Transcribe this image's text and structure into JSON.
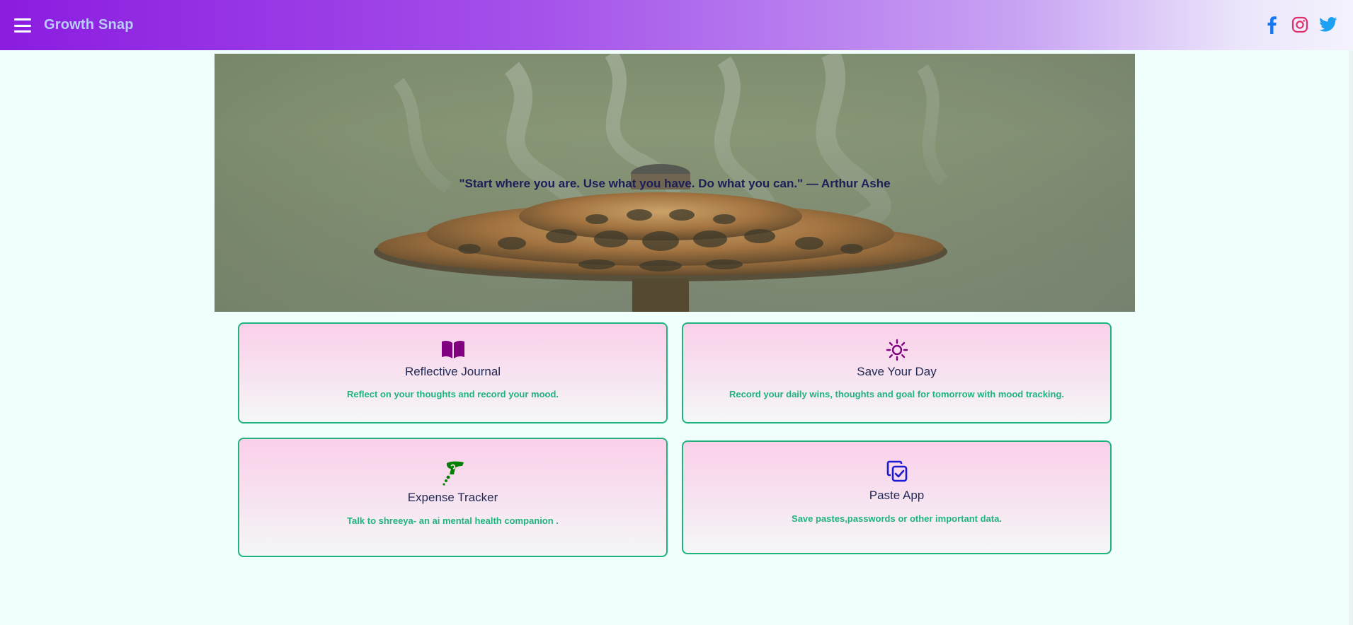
{
  "header": {
    "brand": "Growth Snap",
    "menu_icon": "hamburger-menu-icon",
    "socials": [
      {
        "name": "facebook-icon",
        "color": "#1877f2"
      },
      {
        "name": "instagram-icon",
        "color": "#e1306c"
      },
      {
        "name": "twitter-icon",
        "color": "#1da1f2"
      }
    ]
  },
  "hero": {
    "quote": "\"Start where you are. Use what you have. Do what you can.\" — Arthur Ashe"
  },
  "cards": [
    {
      "title": "Reflective Journal",
      "description": "Reflect on your thoughts and record your mood.",
      "icon": "open-book-icon",
      "icon_color": "#800080"
    },
    {
      "title": "Save Your Day",
      "description": "Record your daily wins, thoughts and goal for tomorrow with mood tracking.",
      "icon": "sun-icon",
      "icon_color": "#800080"
    },
    {
      "title": "Expense Tracker",
      "description": "Talk to shreeya- an ai mental health companion .",
      "icon": "hand-money-icon",
      "icon_color": "#008000"
    },
    {
      "title": "Paste App",
      "description": "Save pastes,passwords or other important data.",
      "icon": "copy-check-icon",
      "icon_color": "#1a1ad0"
    }
  ],
  "colors": {
    "accent": "#1fb47e",
    "title": "#222a55",
    "quote": "#1b1f58"
  }
}
